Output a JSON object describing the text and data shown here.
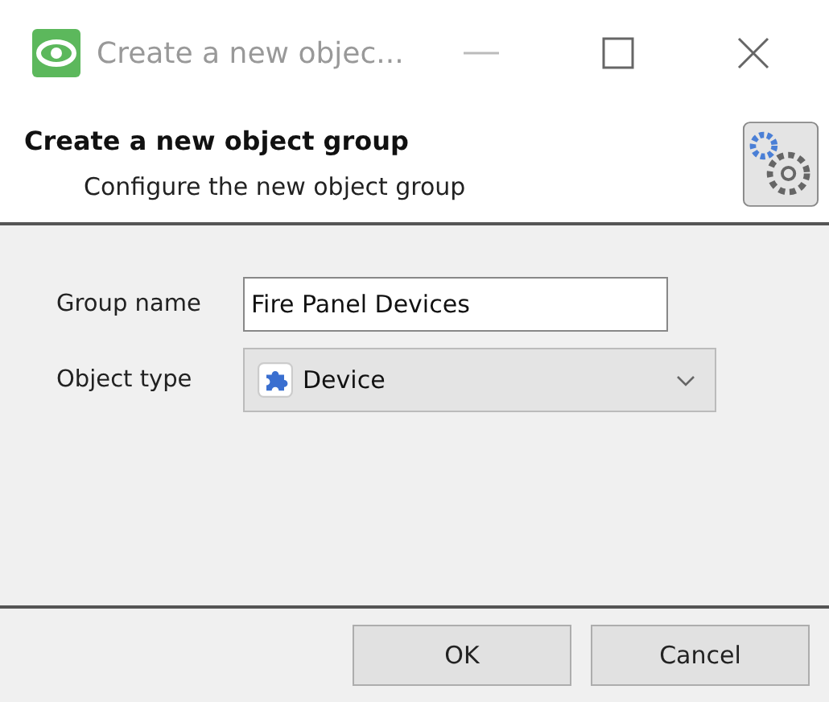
{
  "window": {
    "title": "Create a new objec..."
  },
  "header": {
    "title": "Create a new object group",
    "subtitle": "Configure the new object group"
  },
  "fields": [
    {
      "kind": "text",
      "label": "Group name",
      "value": "Fire Panel Devices"
    },
    {
      "kind": "select",
      "label": "Object type",
      "value": "Device"
    }
  ],
  "buttons": [
    "OK",
    "Cancel"
  ]
}
